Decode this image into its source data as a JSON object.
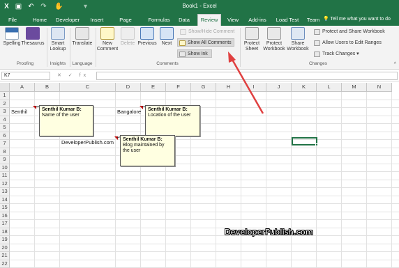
{
  "window": {
    "title": "Book1 - Excel"
  },
  "tabs": [
    "File",
    "Home",
    "Developer",
    "Insert",
    "Page Layout",
    "Formulas",
    "Data",
    "Review",
    "View",
    "Add-ins",
    "Load Test",
    "Team"
  ],
  "active_tab": "Review",
  "tell_me": "Tell me what you want to do",
  "ribbon": {
    "proofing": {
      "spelling": "Spelling",
      "thesaurus": "Thesaurus",
      "label": "Proofing"
    },
    "insights": {
      "smart_lookup_1": "Smart",
      "smart_lookup_2": "Lookup",
      "label": "Insights"
    },
    "language": {
      "translate": "Translate",
      "label": "Language"
    },
    "comments": {
      "new_comment_1": "New",
      "new_comment_2": "Comment",
      "delete": "Delete",
      "previous": "Previous",
      "next": "Next",
      "show_hide": "Show/Hide Comment",
      "show_all": "Show All Comments",
      "show_ink": "Show Ink",
      "label": "Comments"
    },
    "changes": {
      "protect_sheet_1": "Protect",
      "protect_sheet_2": "Sheet",
      "protect_workbook_1": "Protect",
      "protect_workbook_2": "Workbook",
      "share_workbook_1": "Share",
      "share_workbook_2": "Workbook",
      "protect_share": "Protect and Share Workbook",
      "allow_users": "Allow Users to Edit Ranges",
      "track_changes": "Track Changes",
      "label": "Changes"
    }
  },
  "formula_bar": {
    "name_box": "K7",
    "formula": "",
    "icons": "✕ ✓ fx"
  },
  "columns": [
    "A",
    "B",
    "C",
    "D",
    "E",
    "F",
    "G",
    "H",
    "I",
    "J",
    "K",
    "L",
    "M",
    "N"
  ],
  "rows": [
    "1",
    "2",
    "3",
    "4",
    "5",
    "6",
    "7",
    "8",
    "9",
    "10",
    "11",
    "12",
    "13",
    "14",
    "15",
    "16",
    "17",
    "18",
    "19",
    "20",
    "21",
    "22"
  ],
  "cells": {
    "a3": "Senthil",
    "d3": "Bangalore",
    "b7": "DeveloperPublish.com"
  },
  "comments": [
    {
      "author": "Senthil Kumar B:",
      "text": "Name of the user"
    },
    {
      "author": "Senthil Kumar B:",
      "text": "Location of the user"
    },
    {
      "author": "Senthil Kumar B:",
      "text": "Blog maintained by the user"
    }
  ],
  "selected_cell": "K7",
  "watermark": "DeveloperPublish.com",
  "colors": {
    "excel_green": "#217346",
    "comment_bg": "#ffffe1",
    "annotation_arrow": "#e04040"
  }
}
